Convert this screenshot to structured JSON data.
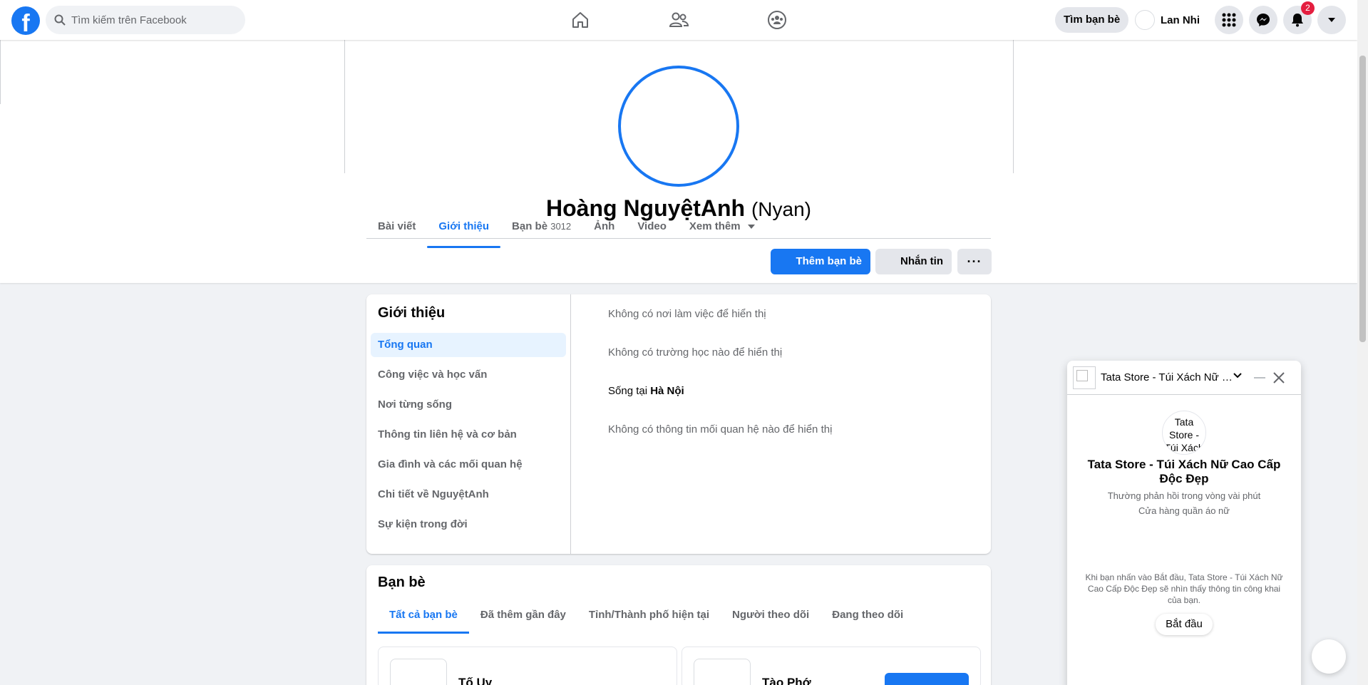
{
  "topbar": {
    "logo_letter": "f",
    "search_placeholder": "Tìm kiếm trên Facebook",
    "find_friends": "Tìm bạn bè",
    "user_name": "Lan Nhi",
    "notification_count": "2"
  },
  "profile": {
    "name": "Hoàng NguyệtAnh",
    "alt_name": "(Nyan)",
    "tabs": [
      {
        "label": "Bài viết"
      },
      {
        "label": "Giới thiệu"
      },
      {
        "label": "Bạn bè",
        "count": "3012"
      },
      {
        "label": "Ảnh"
      },
      {
        "label": "Video"
      },
      {
        "label": "Xem thêm"
      }
    ],
    "add_friend": "Thêm bạn bè",
    "message": "Nhắn tin",
    "more": "···"
  },
  "about": {
    "title": "Giới thiệu",
    "nav": [
      "Tổng quan",
      "Công việc và học vấn",
      "Nơi từng sống",
      "Thông tin liên hệ và cơ bản",
      "Gia đình và các mối quan hệ",
      "Chi tiết về NguyệtAnh",
      "Sự kiện trong đời"
    ],
    "work": "Không có nơi làm việc để hiển thị",
    "school": "Không có trường học nào để hiển thị",
    "lives_prefix": "Sống tại ",
    "lives_city": "Hà Nội",
    "relationship": "Không có thông tin mối quan hệ nào để hiển thị"
  },
  "friends": {
    "title": "Bạn bè",
    "tabs": [
      "Tất cả bạn bè",
      "Đã thêm gần đây",
      "Tỉnh/Thành phố hiện tại",
      "Người theo dõi",
      "Đang theo dõi"
    ],
    "cards": [
      {
        "name": "Tố Uy"
      },
      {
        "name": "Tào Phớ"
      }
    ]
  },
  "chat": {
    "title": "Tata Store - Túi Xách Nữ Cao Cấp Độc Đẹp",
    "logo_alt": "Tata Store - Túi Xách",
    "name": "Tata Store - Túi Xách Nữ Cao Cấp Độc Đẹp",
    "response": "Thường phản hồi trong vòng vài phút",
    "category": "Cửa hàng quần áo nữ",
    "notice": "Khi bạn nhấn vào Bắt đầu, Tata Store - Túi Xách Nữ Cao Cấp Độc Đẹp sẽ nhìn thấy thông tin công khai của bạn.",
    "start": "Bắt đầu"
  },
  "colors": {
    "brand": "#1877f2",
    "badge": "#e41e3f",
    "background": "#f0f2f5"
  }
}
